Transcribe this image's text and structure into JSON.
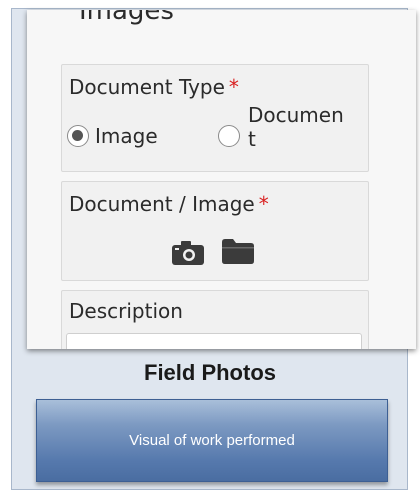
{
  "form": {
    "section_title": "Images",
    "document_type": {
      "label": "Document Type",
      "required_mark": "*",
      "options": [
        {
          "label": "Image",
          "selected": true
        },
        {
          "label_line1": "Documen",
          "label_line2": "t",
          "selected": false
        }
      ]
    },
    "document_image": {
      "label": "Document / Image",
      "required_mark": "*",
      "icons": [
        "camera-icon",
        "folder-icon"
      ]
    },
    "description": {
      "label": "Description",
      "value": ""
    }
  },
  "caption": "Field Photos",
  "banner": {
    "text": "Visual of work performed",
    "colors": {
      "top": "#a9bfda",
      "bottom": "#4a6da1",
      "border": "#3d5f93"
    }
  },
  "colors": {
    "required": "#d92020",
    "frame_bg": "#dfe6ef",
    "frame_border": "#a8b7cb",
    "phone_bg": "#f7f7f7"
  }
}
